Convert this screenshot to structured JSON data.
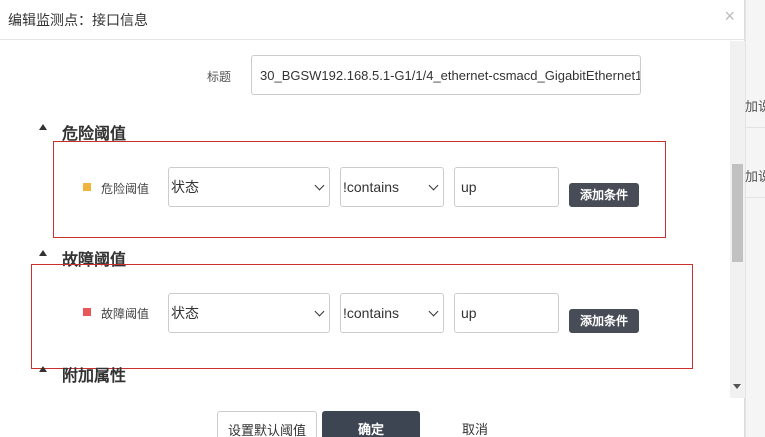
{
  "dialog": {
    "title": "编辑监测点：接口信息",
    "close_glyph": "×"
  },
  "background": {
    "cells": [
      "加说",
      "加说"
    ]
  },
  "form": {
    "title_label": "标题",
    "title_value": "30_BGSW192.168.5.1-G1/1/4_ethernet-csmacd_GigabitEthernet1"
  },
  "sections": {
    "danger": {
      "heading": "危险阈值",
      "rule_label": "危险阈值",
      "color": "#f0b33c",
      "field": "状态",
      "operator": "!contains",
      "value": "up",
      "add_label": "添加条件"
    },
    "fault": {
      "heading": "故障阈值",
      "rule_label": "故障阈值",
      "color": "#e9575a",
      "field": "状态",
      "operator": "!contains",
      "value": "up",
      "add_label": "添加条件"
    },
    "extra": {
      "heading": "附加属性"
    }
  },
  "footer": {
    "default_label": "设置默认阈值",
    "confirm_label": "确定",
    "cancel_label": "取消"
  }
}
